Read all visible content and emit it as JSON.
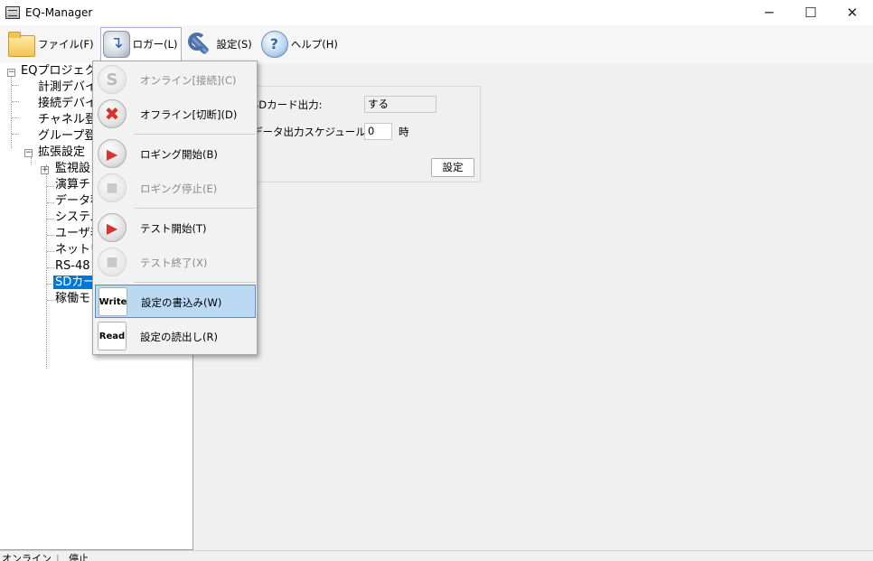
{
  "window": {
    "title": "EQ-Manager"
  },
  "menubar": {
    "items": [
      {
        "label": "ファイル(F)",
        "icon": "folder-icon"
      },
      {
        "label": "ロガー(L)",
        "icon": "logger-icon"
      },
      {
        "label": "設定(S)",
        "icon": "wrench-icon"
      },
      {
        "label": "ヘルプ(H)",
        "icon": "help-icon"
      }
    ]
  },
  "tree": {
    "root": "EQプロジェクト",
    "items": [
      "計測デバイ",
      "接続デバイ",
      "チャネル登",
      "グループ登",
      "拡張設定",
      "監視設",
      "演算チ",
      "データ種",
      "システム",
      "ユーザ表",
      "ネットワ",
      "RS-48",
      "SDカー",
      "稼働モ"
    ],
    "selected": "SDカー"
  },
  "panel": {
    "sd_output_label": "SDカード出力:",
    "sd_output_value": "する",
    "schedule_label": "データ出力スケジュール:",
    "schedule_value": "0",
    "schedule_unit": "時",
    "set_button": "設定"
  },
  "logger_menu": {
    "items": [
      {
        "label": "オンライン[接続](C)",
        "enabled": false,
        "icon": "online-icon"
      },
      {
        "label": "オフライン[切断](D)",
        "enabled": true,
        "icon": "offline-icon"
      },
      {
        "label": "ロギング開始(B)",
        "enabled": true,
        "icon": "logging-start-icon"
      },
      {
        "label": "ロギング停止(E)",
        "enabled": false,
        "icon": "logging-stop-icon"
      },
      {
        "label": "テスト開始(T)",
        "enabled": true,
        "icon": "test-start-icon"
      },
      {
        "label": "テスト終了(X)",
        "enabled": false,
        "icon": "test-end-icon"
      },
      {
        "label": "設定の書込み(W)",
        "enabled": true,
        "icon": "write-icon",
        "highlighted": true
      },
      {
        "label": "設定の読出し(R)",
        "enabled": true,
        "icon": "read-icon"
      }
    ],
    "write_icon_text": "Write",
    "read_icon_text": "Read"
  },
  "statusbar": {
    "connection": "オンライン",
    "state": "停止"
  },
  "colors": {
    "selection": "#0078d7",
    "menu_highlight": "#bcd9f4",
    "accent_red": "#d6342c"
  }
}
